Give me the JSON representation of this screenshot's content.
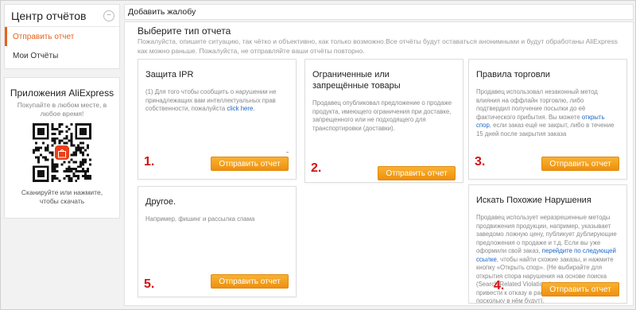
{
  "sidebar": {
    "title": "Центр отчётов",
    "items": [
      {
        "label": "Отправить отчет",
        "active": true
      },
      {
        "label": "Мои Отчёты",
        "active": false
      }
    ]
  },
  "app_promo": {
    "title": "Приложения AliExpress",
    "subtitle_line1": "Покупайте в любом месте, в",
    "subtitle_line2": "любое время!",
    "scan_line1": "Сканируйте или нажмите,",
    "scan_line2": "чтобы скачать"
  },
  "header": {
    "title": "Добавить жалобу"
  },
  "main": {
    "title": "Выберите тип отчета",
    "desc": "Пожалуйста, опишите ситуацию, так чётко и объективно, как только возможно.Все отчёты будут оставаться анонимными и будут обработаны AliExpress как можно раньше. Пожалуйста, не отправляйте ваши отчёты повторно."
  },
  "cards": {
    "ipr": {
      "title": "Защита IPR",
      "text": "(1) Для того чтобы сообщить о нарушении не принадлежащих вам интеллектуальных прав собственности, пожалуйста ",
      "link": "click here",
      "text_end": ".",
      "button": "Отправить отчет",
      "marker": "1."
    },
    "restricted": {
      "title": "Ограниченные или запрещённые товары",
      "text": "Продавец опубликовал предложение о продаже продукта, имеющего ограничения при доставке, запрещенного или не подходящего для транспортировки (доставки).",
      "button": "Отправить отчет",
      "marker": "2."
    },
    "trade": {
      "title": "Правила торговли",
      "text": "Продавец использовал незаконный метод влияния на оффлайн торговлю, либо подтвердил получение посылки до её фактического прибытия. Вы можете ",
      "link": "открыть спор",
      "text_end": ", если заказ ещё не закрыт, либо в течение 15 дней после закрытия заказа",
      "button": "Отправить отчет",
      "marker": "3."
    },
    "other": {
      "title": "Другое.",
      "text": "Например, фишинг и рассылка спама",
      "button": "Отправить отчет",
      "marker": "5."
    },
    "similar": {
      "title": "Искать Похожие Нарушения",
      "text": "Продавец использует неразрешенные методы продвижения продукции, например, указывает заведомо ложную цену, публикует дублирующие предложения о продаже и т.д. Если вы уже оформили свой заказ, ",
      "link": "перейдите по следующей ссылке",
      "text_end": ", чтобы найти схожие заказы, и нажмите кнопку «Открыть спор». (Не выбирайте для открытия спора нарушения на основе поиска (Search Related Violations), так как это может привести к отказу в рассмотрении вашего спора, поскольку в нём будут).",
      "button": "Отправить отчет",
      "marker": "4."
    }
  }
}
